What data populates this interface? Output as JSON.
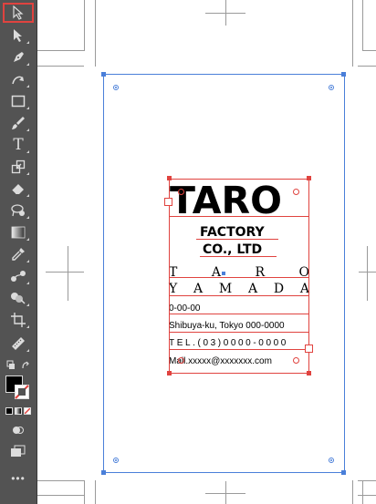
{
  "toolbar": {
    "tools": [
      {
        "name": "selection-tool",
        "icon": "selection-arrow-icon",
        "selected": true
      },
      {
        "name": "direct-selection-tool",
        "icon": "direct-selection-arrow-icon"
      },
      {
        "name": "pen-tool",
        "icon": "pen-icon"
      },
      {
        "name": "curvature-tool",
        "icon": "curvature-icon"
      },
      {
        "name": "rectangle-tool",
        "icon": "rectangle-icon"
      },
      {
        "name": "paintbrush-tool",
        "icon": "paintbrush-icon"
      },
      {
        "name": "type-tool",
        "icon": "type-icon",
        "label": "T"
      },
      {
        "name": "scale-tool",
        "icon": "scale-icon"
      },
      {
        "name": "eraser-tool",
        "icon": "eraser-icon"
      },
      {
        "name": "lasso-tool",
        "icon": "lasso-icon"
      },
      {
        "name": "gradient-tool",
        "icon": "gradient-icon"
      },
      {
        "name": "eyedropper-tool",
        "icon": "eyedropper-icon"
      },
      {
        "name": "blend-tool",
        "icon": "blend-icon"
      },
      {
        "name": "shape-builder-tool",
        "icon": "shape-builder-icon"
      },
      {
        "name": "artboard-tool",
        "icon": "artboard-icon"
      },
      {
        "name": "measure-tool",
        "icon": "ruler-icon"
      },
      {
        "name": "hand-tool",
        "icon": "hand-icon"
      }
    ],
    "fill_color": "#000000",
    "stroke_color": "none",
    "more_label": "•••"
  },
  "card": {
    "title": "TARO",
    "company_line1": "FACTORY",
    "company_line2": "CO., LTD",
    "name_first_letters": [
      "T",
      "A",
      "R",
      "O"
    ],
    "name_last_letters": [
      "Y",
      "A",
      "M",
      "A",
      "D",
      "A"
    ],
    "postal": "0-00-00",
    "address": "Shibuya-ku, Tokyo 000-0000",
    "tel": "TEL.(03)0000-0000",
    "mail": "Mail.xxxxx@xxxxxxx.com"
  },
  "colors": {
    "toolbar_bg": "#535353",
    "artboard_selection": "#4a7fd9",
    "object_selection": "#e0433f"
  }
}
